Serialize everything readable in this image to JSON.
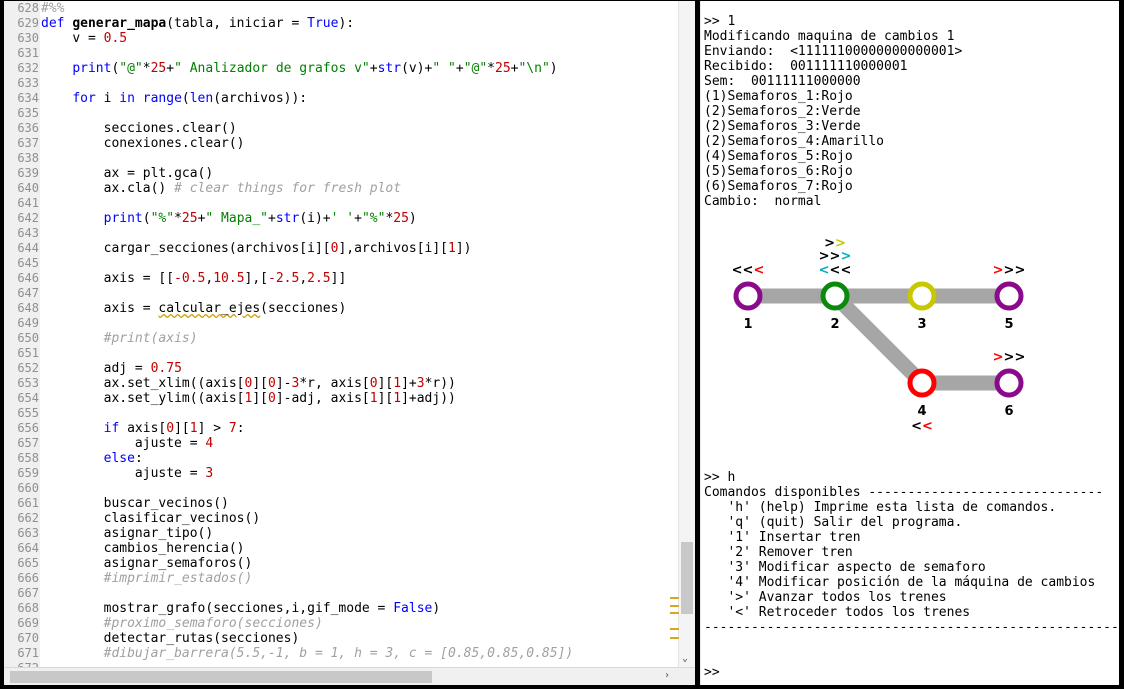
{
  "editor": {
    "lines": [
      {
        "n": "628",
        "x": 0,
        "segs": [
          {
            "c": "cm",
            "t": "#%%"
          }
        ]
      },
      {
        "n": "629",
        "x": 0,
        "segs": [
          {
            "c": "kw",
            "t": "def "
          },
          {
            "c": "fn",
            "t": "generar_mapa"
          },
          {
            "t": "(tabla, iniciar = "
          },
          {
            "c": "kw",
            "t": "True"
          },
          {
            "t": "):"
          }
        ]
      },
      {
        "n": "630",
        "x": 4,
        "segs": [
          {
            "t": "v = "
          },
          {
            "c": "num",
            "t": "0.5"
          }
        ]
      },
      {
        "n": "631",
        "x": 0,
        "segs": []
      },
      {
        "n": "632",
        "x": 4,
        "segs": [
          {
            "c": "kw",
            "t": "print"
          },
          {
            "t": "("
          },
          {
            "c": "str",
            "t": "\"@\""
          },
          {
            "t": "*"
          },
          {
            "c": "num",
            "t": "25"
          },
          {
            "t": "+"
          },
          {
            "c": "str",
            "t": "\" Analizador de grafos v\""
          },
          {
            "t": "+"
          },
          {
            "c": "kw",
            "t": "str"
          },
          {
            "t": "(v)+"
          },
          {
            "c": "str",
            "t": "\" \""
          },
          {
            "t": "+"
          },
          {
            "c": "str",
            "t": "\"@\""
          },
          {
            "t": "*"
          },
          {
            "c": "num",
            "t": "25"
          },
          {
            "t": "+"
          },
          {
            "c": "str",
            "t": "\"\\n\""
          },
          {
            "t": ")"
          }
        ]
      },
      {
        "n": "633",
        "x": 0,
        "segs": []
      },
      {
        "n": "634",
        "x": 4,
        "segs": [
          {
            "c": "kw",
            "t": "for"
          },
          {
            "t": " i "
          },
          {
            "c": "kw",
            "t": "in"
          },
          {
            "t": " "
          },
          {
            "c": "kw",
            "t": "range"
          },
          {
            "t": "("
          },
          {
            "c": "kw",
            "t": "len"
          },
          {
            "t": "(archivos)):"
          }
        ]
      },
      {
        "n": "635",
        "x": 0,
        "segs": []
      },
      {
        "n": "636",
        "x": 8,
        "segs": [
          {
            "t": "secciones.clear()"
          }
        ]
      },
      {
        "n": "637",
        "x": 8,
        "segs": [
          {
            "t": "conexiones.clear()"
          }
        ]
      },
      {
        "n": "638",
        "x": 0,
        "segs": []
      },
      {
        "n": "639",
        "x": 8,
        "segs": [
          {
            "t": "ax = plt.gca()"
          }
        ]
      },
      {
        "n": "640",
        "x": 8,
        "segs": [
          {
            "t": "ax.cla() "
          },
          {
            "c": "cm",
            "t": "# clear things for fresh plot"
          }
        ]
      },
      {
        "n": "641",
        "x": 0,
        "segs": []
      },
      {
        "n": "642",
        "x": 8,
        "segs": [
          {
            "c": "kw",
            "t": "print"
          },
          {
            "t": "("
          },
          {
            "c": "str",
            "t": "\"%\""
          },
          {
            "t": "*"
          },
          {
            "c": "num",
            "t": "25"
          },
          {
            "t": "+"
          },
          {
            "c": "str",
            "t": "\" Mapa_\""
          },
          {
            "t": "+"
          },
          {
            "c": "kw",
            "t": "str"
          },
          {
            "t": "(i)+"
          },
          {
            "c": "str",
            "t": "' '"
          },
          {
            "t": "+"
          },
          {
            "c": "str",
            "t": "\"%\""
          },
          {
            "t": "*"
          },
          {
            "c": "num",
            "t": "25"
          },
          {
            "t": ")"
          }
        ]
      },
      {
        "n": "643",
        "x": 0,
        "segs": []
      },
      {
        "n": "644",
        "x": 8,
        "segs": [
          {
            "t": "cargar_secciones(archivos[i]["
          },
          {
            "c": "num",
            "t": "0"
          },
          {
            "t": "],archivos[i]["
          },
          {
            "c": "num",
            "t": "1"
          },
          {
            "t": "])"
          }
        ]
      },
      {
        "n": "645",
        "x": 0,
        "segs": []
      },
      {
        "n": "646",
        "x": 8,
        "segs": [
          {
            "t": "axis = [["
          },
          {
            "c": "num",
            "t": "-0.5"
          },
          {
            "t": ","
          },
          {
            "c": "num",
            "t": "10.5"
          },
          {
            "t": "],["
          },
          {
            "c": "num",
            "t": "-2.5"
          },
          {
            "t": ","
          },
          {
            "c": "num",
            "t": "2.5"
          },
          {
            "t": "]]"
          }
        ]
      },
      {
        "n": "647",
        "x": 0,
        "segs": []
      },
      {
        "n": "648",
        "x": 8,
        "segs": [
          {
            "t": "axis = "
          },
          {
            "c": "wavy",
            "t": "calcular_ejes"
          },
          {
            "t": "(secciones)"
          }
        ]
      },
      {
        "n": "649",
        "x": 0,
        "segs": []
      },
      {
        "n": "650",
        "x": 8,
        "segs": [
          {
            "c": "cm",
            "t": "#print(axis)"
          }
        ]
      },
      {
        "n": "651",
        "x": 0,
        "segs": []
      },
      {
        "n": "652",
        "x": 8,
        "segs": [
          {
            "t": "adj = "
          },
          {
            "c": "num",
            "t": "0.75"
          }
        ]
      },
      {
        "n": "653",
        "x": 8,
        "segs": [
          {
            "t": "ax.set_xlim((axis["
          },
          {
            "c": "num",
            "t": "0"
          },
          {
            "t": "]["
          },
          {
            "c": "num",
            "t": "0"
          },
          {
            "t": "]-"
          },
          {
            "c": "num",
            "t": "3"
          },
          {
            "t": "*r, axis["
          },
          {
            "c": "num",
            "t": "0"
          },
          {
            "t": "]["
          },
          {
            "c": "num",
            "t": "1"
          },
          {
            "t": "]+"
          },
          {
            "c": "num",
            "t": "3"
          },
          {
            "t": "*r))"
          }
        ]
      },
      {
        "n": "654",
        "x": 8,
        "segs": [
          {
            "t": "ax.set_ylim((axis["
          },
          {
            "c": "num",
            "t": "1"
          },
          {
            "t": "]["
          },
          {
            "c": "num",
            "t": "0"
          },
          {
            "t": "]-adj, axis["
          },
          {
            "c": "num",
            "t": "1"
          },
          {
            "t": "]["
          },
          {
            "c": "num",
            "t": "1"
          },
          {
            "t": "]+adj))"
          }
        ]
      },
      {
        "n": "655",
        "x": 0,
        "segs": []
      },
      {
        "n": "656",
        "x": 8,
        "segs": [
          {
            "c": "kw",
            "t": "if"
          },
          {
            "t": " axis["
          },
          {
            "c": "num",
            "t": "0"
          },
          {
            "t": "]["
          },
          {
            "c": "num",
            "t": "1"
          },
          {
            "t": "] > "
          },
          {
            "c": "num",
            "t": "7"
          },
          {
            "t": ":"
          }
        ]
      },
      {
        "n": "657",
        "x": 12,
        "segs": [
          {
            "t": "ajuste = "
          },
          {
            "c": "num",
            "t": "4"
          }
        ]
      },
      {
        "n": "658",
        "x": 8,
        "segs": [
          {
            "c": "kw",
            "t": "else"
          },
          {
            "t": ":"
          }
        ]
      },
      {
        "n": "659",
        "x": 12,
        "segs": [
          {
            "t": "ajuste = "
          },
          {
            "c": "num",
            "t": "3"
          }
        ]
      },
      {
        "n": "660",
        "x": 0,
        "segs": []
      },
      {
        "n": "661",
        "x": 8,
        "segs": [
          {
            "t": "buscar_vecinos()"
          }
        ]
      },
      {
        "n": "662",
        "x": 8,
        "segs": [
          {
            "t": "clasificar_vecinos()"
          }
        ]
      },
      {
        "n": "663",
        "x": 8,
        "segs": [
          {
            "t": "asignar_tipo()"
          }
        ]
      },
      {
        "n": "664",
        "x": 8,
        "segs": [
          {
            "t": "cambios_herencia()"
          }
        ]
      },
      {
        "n": "665",
        "x": 8,
        "segs": [
          {
            "t": "asignar_semaforos()"
          }
        ]
      },
      {
        "n": "666",
        "x": 8,
        "segs": [
          {
            "c": "cm",
            "t": "#imprimir_estados()"
          }
        ]
      },
      {
        "n": "667",
        "x": 0,
        "segs": []
      },
      {
        "n": "668",
        "x": 8,
        "segs": [
          {
            "t": "mostrar_grafo(secciones,i,gif_mode = "
          },
          {
            "c": "kw",
            "t": "False"
          },
          {
            "t": ")"
          }
        ]
      },
      {
        "n": "669",
        "x": 8,
        "segs": [
          {
            "c": "cm",
            "t": "#proximo_semaforo(secciones)"
          }
        ]
      },
      {
        "n": "670",
        "x": 8,
        "segs": [
          {
            "t": "detectar_rutas(secciones)"
          }
        ]
      },
      {
        "n": "671",
        "x": 8,
        "segs": [
          {
            "c": "cm",
            "t": "#dibujar_barrera(5.5,-1, b = 1, h = 3, c = [0.85,0.85,0.85])"
          }
        ]
      },
      {
        "n": "672",
        "x": 0,
        "segs": []
      }
    ]
  },
  "console": {
    "top_lines": [
      ">> 1",
      "Modificando maquina de cambios 1",
      "Enviando:  <11111100000000000001>",
      "Recibido:  001111110000001",
      "Sem:  00111111000000",
      "(1)Semaforos_1:Rojo",
      "(2)Semaforos_2:Verde",
      "(2)Semaforos_3:Verde",
      "(2)Semaforos_4:Amarillo",
      "(4)Semaforos_5:Rojo",
      "(5)Semaforos_6:Rojo",
      "(6)Semaforos_7:Rojo",
      "Cambio:  normal"
    ],
    "bottom_lines": [
      ">> h",
      "Comandos disponibles ------------------------------",
      "   'h' (help) Imprime esta lista de comandos.",
      "   'q' (quit) Salir del programa.",
      "   '1' Insertar tren",
      "   '2' Remover tren",
      "   '3' Modificar aspecto de semaforo",
      "   '4' Modificar posición de la máquina de cambios",
      "   '>' Avanzar todos los trenes",
      "   '<' Retroceder todos los trenes",
      "------------------------------------------------------"
    ],
    "prompt": ">>"
  },
  "graph": {
    "edge_color": "#a6a6a6",
    "nodes": [
      {
        "id": "1",
        "label": "1",
        "color": "#8b0a8b"
      },
      {
        "id": "2",
        "label": "2",
        "color": "#0a8a0a"
      },
      {
        "id": "3",
        "label": "3",
        "color": "#c8c800"
      },
      {
        "id": "5",
        "label": "5",
        "color": "#8b0a8b"
      },
      {
        "id": "4",
        "label": "4",
        "color": "#ff0000"
      },
      {
        "id": "6",
        "label": "6",
        "color": "#8b0a8b"
      }
    ],
    "edges": [
      [
        "1",
        "2"
      ],
      [
        "2",
        "3"
      ],
      [
        "3",
        "5"
      ],
      [
        "2",
        "4"
      ],
      [
        "4",
        "6"
      ]
    ],
    "signals": [
      {
        "node": "1",
        "pos": "above",
        "glyphs": [
          {
            "t": "<",
            "c": "#000000"
          },
          {
            "t": "<",
            "c": "#000000"
          },
          {
            "t": "<",
            "c": "#ff0000"
          }
        ]
      },
      {
        "node": "2",
        "pos": "above2",
        "glyphs": [
          {
            "t": ">",
            "c": "#000000"
          },
          {
            "t": ">",
            "c": "#c8c800"
          }
        ]
      },
      {
        "node": "2",
        "pos": "above1",
        "glyphs": [
          {
            "t": ">",
            "c": "#000000"
          },
          {
            "t": ">",
            "c": "#000000"
          },
          {
            "t": ">",
            "c": "#00b0c0"
          }
        ]
      },
      {
        "node": "2",
        "pos": "above",
        "glyphs": [
          {
            "t": "<",
            "c": "#00b0c0"
          },
          {
            "t": "<",
            "c": "#000000"
          },
          {
            "t": "<",
            "c": "#000000"
          }
        ]
      },
      {
        "node": "5",
        "pos": "above",
        "glyphs": [
          {
            "t": ">",
            "c": "#ff0000"
          },
          {
            "t": ">",
            "c": "#000000"
          },
          {
            "t": ">",
            "c": "#000000"
          }
        ]
      },
      {
        "node": "6",
        "pos": "above",
        "glyphs": [
          {
            "t": ">",
            "c": "#ff0000"
          },
          {
            "t": ">",
            "c": "#000000"
          },
          {
            "t": ">",
            "c": "#000000"
          }
        ]
      },
      {
        "node": "4",
        "pos": "below",
        "glyphs": [
          {
            "t": "<",
            "c": "#000000"
          },
          {
            "t": "<",
            "c": "#ff0000"
          }
        ]
      }
    ]
  }
}
